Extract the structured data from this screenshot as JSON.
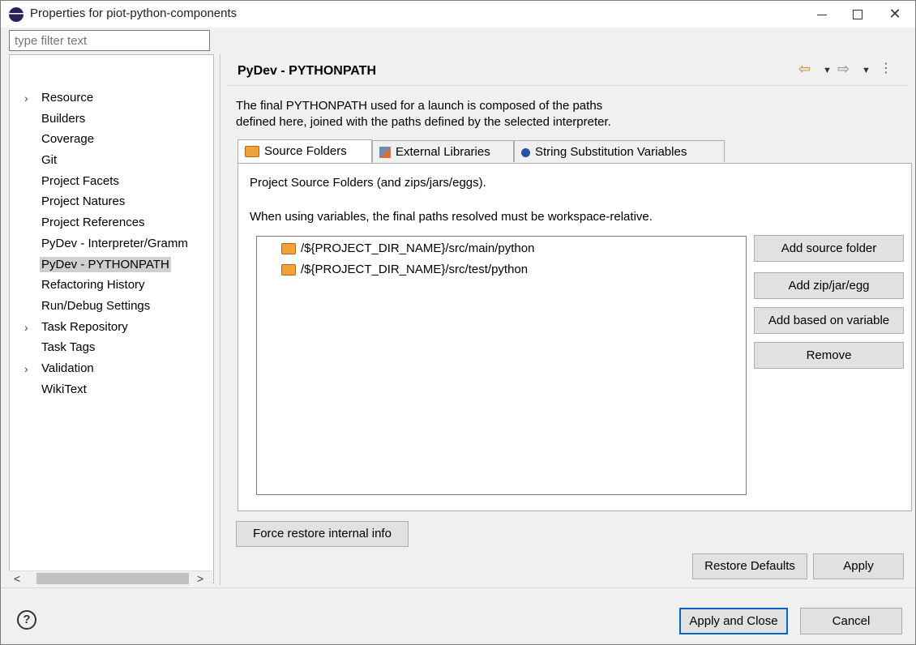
{
  "window": {
    "title": "Properties for piot-python-components",
    "minimize_glyph": "—",
    "close_glyph": "✕"
  },
  "left": {
    "filter_placeholder": "type filter text",
    "tree": [
      {
        "label": "Resource",
        "expandable": true
      },
      {
        "label": "Builders"
      },
      {
        "label": "Coverage"
      },
      {
        "label": "Git"
      },
      {
        "label": "Project Facets"
      },
      {
        "label": "Project Natures"
      },
      {
        "label": "Project References"
      },
      {
        "label": "PyDev - Interpreter/Gramm"
      },
      {
        "label": "PyDev - PYTHONPATH",
        "selected": true
      },
      {
        "label": "Refactoring History"
      },
      {
        "label": "Run/Debug Settings"
      },
      {
        "label": "Task Repository",
        "expandable": true
      },
      {
        "label": "Task Tags"
      },
      {
        "label": "Validation",
        "expandable": true
      },
      {
        "label": "WikiText"
      }
    ],
    "scroll_left": "<",
    "scroll_right": ">"
  },
  "page": {
    "title": "PyDev - PYTHONPATH",
    "description_line1": "The final PYTHONPATH used for a launch is composed of the paths",
    "description_line2": "defined here, joined with the paths defined by the selected interpreter.",
    "tabs": [
      {
        "label": "Source Folders",
        "icon": "folder-icon"
      },
      {
        "label": "External Libraries",
        "icon": "library-icon"
      },
      {
        "label": "String Substitution Variables",
        "icon": "variable-icon"
      }
    ],
    "panel_line1": "Project Source Folders (and zips/jars/eggs).",
    "panel_line2": "When using variables, the final paths resolved must be workspace-relative.",
    "paths": [
      "/${PROJECT_DIR_NAME}/src/main/python",
      "/${PROJECT_DIR_NAME}/src/test/python"
    ],
    "buttons": {
      "add_source_folder": "Add source folder",
      "add_zip": "Add zip/jar/egg",
      "add_variable": "Add based on variable",
      "remove": "Remove",
      "force_restore": "Force restore internal info",
      "restore_defaults": "Restore Defaults",
      "apply": "Apply"
    }
  },
  "footer": {
    "help": "?",
    "apply_and_close": "Apply and Close",
    "cancel": "Cancel"
  },
  "colors": {
    "accent_border": "#0a64c8",
    "selection": "#cfcfcf",
    "folder_icon": "#f2a23c"
  }
}
